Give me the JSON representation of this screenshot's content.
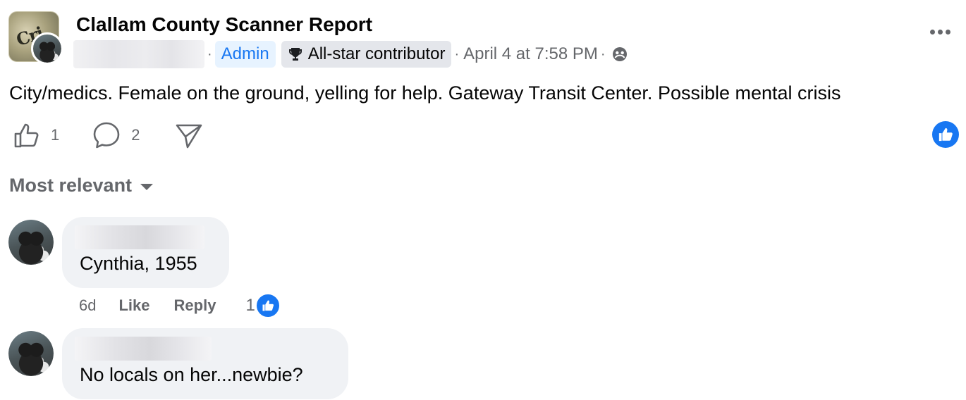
{
  "post": {
    "group_name": "Clallam County Scanner Report",
    "group_avatar_text": "Cri",
    "admin_badge": "Admin",
    "allstar_badge": "All-star contributor",
    "timestamp": "April 4 at 7:58 PM",
    "separator": "·",
    "body": "City/medics. Female on the ground, yelling for help. Gateway Transit Center.  Possible mental crisis",
    "like_count": "1",
    "comment_count": "2",
    "icons": {
      "more": "more-options-icon",
      "privacy": "group-audience-icon",
      "badge": "trophy-icon",
      "like": "thumbs-up-icon",
      "comment": "comment-bubble-icon",
      "share": "share-icon",
      "reaction": "like-reaction-icon"
    },
    "colors": {
      "accent": "#1877f2",
      "secondary_text": "#65676b",
      "bubble_bg": "#f0f2f5",
      "admin_bg": "#e7f3ff",
      "badge_bg": "#e4e6eb"
    }
  },
  "comments_section": {
    "sort_label": "Most relevant",
    "comments": [
      {
        "text": "Cynthia, 1955",
        "time": "6d",
        "like_label": "Like",
        "reply_label": "Reply",
        "reaction_count": "1"
      },
      {
        "text": "No locals on her...newbie?"
      }
    ]
  }
}
